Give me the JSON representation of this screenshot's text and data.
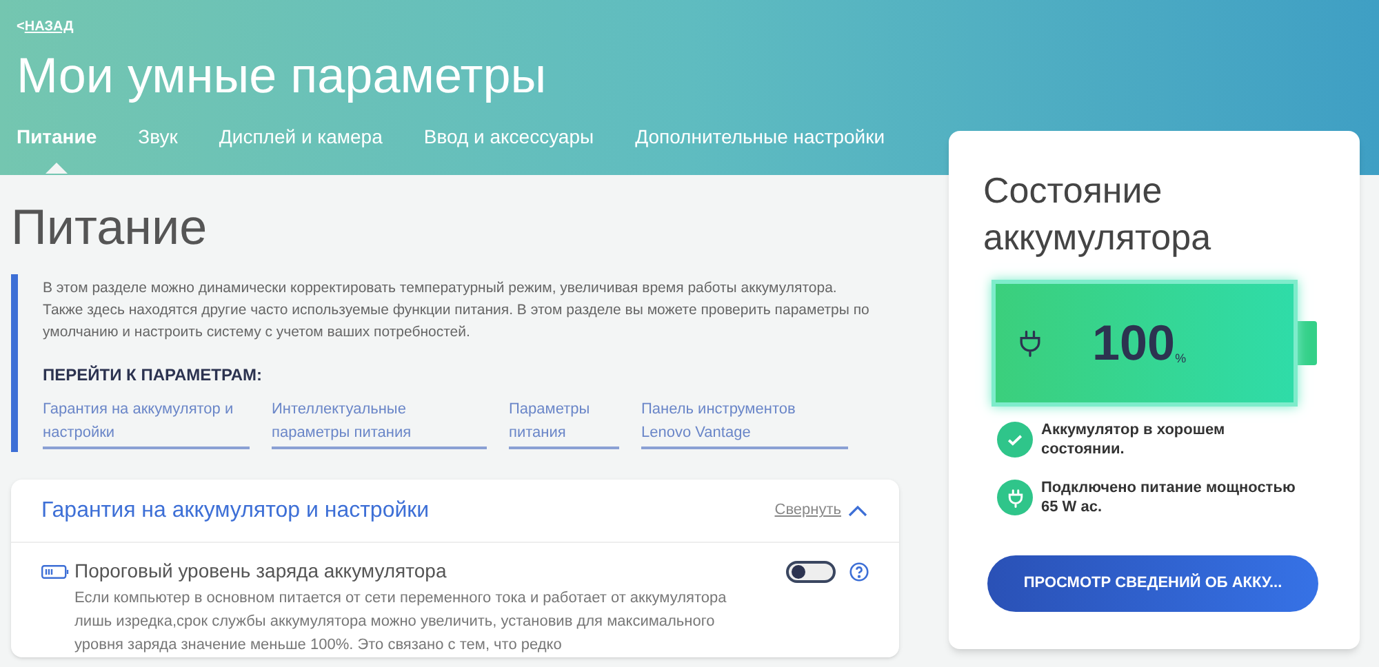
{
  "header": {
    "back_link": "НАЗАД",
    "back_arrow": "<",
    "title": "Мои умные параметры"
  },
  "tabs": [
    {
      "label": "Питание",
      "selected": true
    },
    {
      "label": "Звук",
      "selected": false
    },
    {
      "label": "Дисплей и камера",
      "selected": false
    },
    {
      "label": "Ввод и аксессуары",
      "selected": false
    },
    {
      "label": "Дополнительные настройки",
      "selected": false
    }
  ],
  "section": {
    "title": "Питание",
    "description": "В этом разделе можно динамически корректировать температурный режим, увеличивая время работы аккумулятора. Также здесь находятся другие часто используемые функции питания. В этом разделе вы можете проверить параметры по умолчанию и настроить систему с учетом ваших потребностей.",
    "goto_heading": "ПЕРЕЙТИ К ПАРАМЕТРАМ:",
    "links": [
      "Гарантия на аккумулятор и настройки",
      "Интеллектуальные параметры питания",
      "Параметры питания",
      "Панель инструментов Lenovo Vantage"
    ]
  },
  "panel": {
    "title": "Гарантия на аккумулятор и настройки",
    "collapse_link": "Свернуть",
    "expanded": true,
    "items": [
      {
        "title": "Пороговый уровень заряда аккумулятора",
        "on": false,
        "description": "Если компьютер в основном питается от сети переменного тока и работает от аккумулятора лишь изредка,срок службы аккумулятора можно увеличить, установив для максимального уровня заряда значение меньше 100%. Это связано с тем, что редко"
      }
    ]
  },
  "battery_card": {
    "title": "Состояние аккумулятора",
    "level": 1.0,
    "percent": "100",
    "unit": "%",
    "statuses": [
      {
        "kind": "check",
        "text": "Аккумулятор в хорошем состоянии."
      },
      {
        "kind": "plug",
        "text": "Подключено питание мощностью 65 W ac."
      }
    ],
    "button": "ПРОСМОТР СВЕДЕНИЙ ОБ АККУ..."
  }
}
